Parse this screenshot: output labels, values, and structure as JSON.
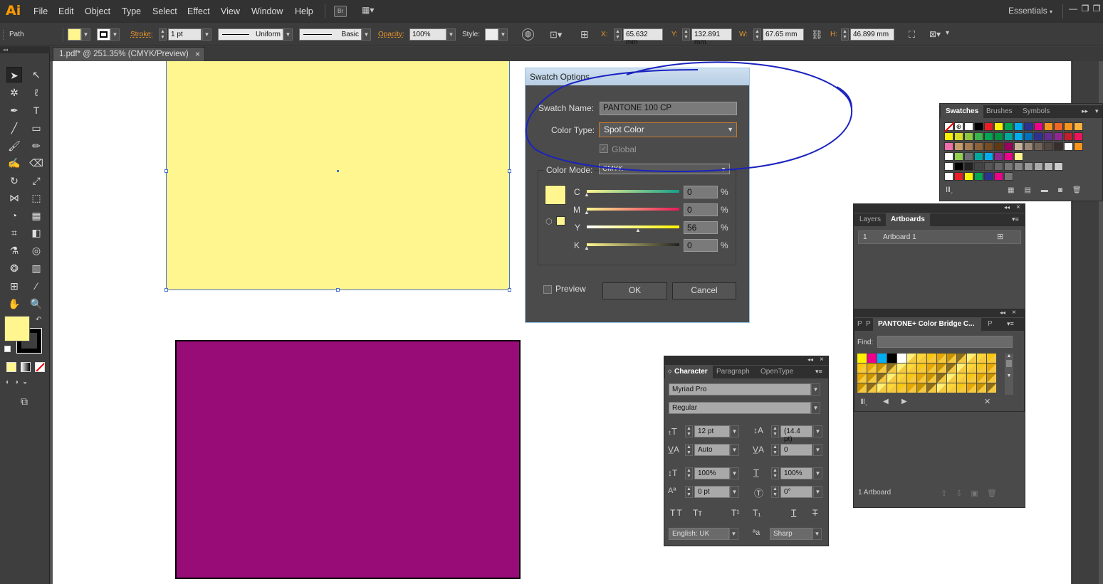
{
  "app": {
    "logo": "Ai",
    "workspace": "Essentials"
  },
  "menu": [
    "File",
    "Edit",
    "Object",
    "Type",
    "Select",
    "Effect",
    "View",
    "Window",
    "Help"
  ],
  "menu_extra": {
    "bridge": "Br"
  },
  "control": {
    "selection": "Path",
    "stroke_label": "Stroke:",
    "stroke_weight": "1 pt",
    "profile": "Uniform",
    "brush": "Basic",
    "opacity_label": "Opacity:",
    "opacity": "100%",
    "style_label": "Style:",
    "x_label": "X:",
    "x": "65.632 mm",
    "y_label": "Y:",
    "y": "132.891 mm",
    "w_label": "W:",
    "w": "67.65 mm",
    "h_label": "H:",
    "h": "46.899 mm"
  },
  "doc_tab": {
    "title": "1.pdf* @ 251.35% (CMYK/Preview)",
    "close": "×"
  },
  "colors": {
    "yellow_fill": "#fff68f",
    "purple_fill": "#970c76",
    "accent": "#ff9a00",
    "annotation": "#1a22bf"
  },
  "swatch_dialog": {
    "title": "Swatch Options",
    "name_label": "Swatch Name:",
    "name_value": "PANTONE 100 CP",
    "type_label": "Color Type:",
    "type_value": "Spot Color",
    "global_label": "Global",
    "mode_label": "Color Mode:",
    "mode_value": "CMYK",
    "channels": [
      {
        "label": "C",
        "value": "0",
        "unit": "%"
      },
      {
        "label": "M",
        "value": "0",
        "unit": "%"
      },
      {
        "label": "Y",
        "value": "56",
        "unit": "%"
      },
      {
        "label": "K",
        "value": "0",
        "unit": "%"
      }
    ],
    "preview_label": "Preview",
    "ok": "OK",
    "cancel": "Cancel"
  },
  "swatches_panel": {
    "tabs": [
      "Swatches",
      "Brushes",
      "Symbols"
    ]
  },
  "layers_panel": {
    "tabs": [
      "Layers",
      "Artboards"
    ],
    "row": {
      "num": "1",
      "name": "Artboard 1"
    },
    "footer": "1 Artboard"
  },
  "pantone_panel": {
    "tabs": [
      "P",
      "P",
      "PANTONE+ Color Bridge C...",
      "P"
    ],
    "find_label": "Find:"
  },
  "character_panel": {
    "tabs": [
      "Character",
      "Paragraph",
      "OpenType"
    ],
    "font": "Myriad Pro",
    "style": "Regular",
    "size": "12 pt",
    "leading": "(14.4 pt)",
    "kerning": "Auto",
    "tracking": "0",
    "vscale": "100%",
    "hscale": "100%",
    "baseline": "0 pt",
    "rotation": "0°",
    "language": "English: UK",
    "aa": "Sharp"
  }
}
